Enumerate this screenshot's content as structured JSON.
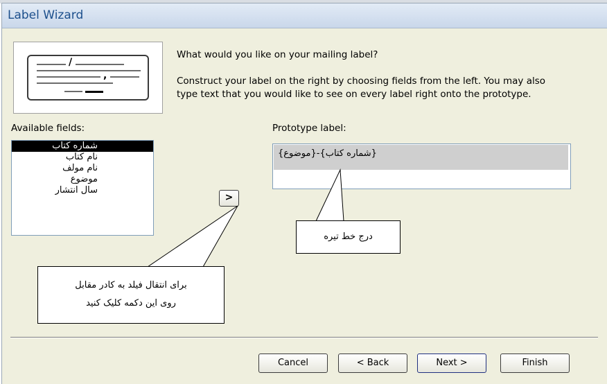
{
  "dialog": {
    "title": "Label Wizard",
    "heading": "What would you like on your mailing label?",
    "instructions_1": "Construct your label on the right by choosing fields from the left. You may also",
    "instructions_2": "type text that you would like to see on every label right onto the prototype."
  },
  "available_fields": {
    "label": "Available fields:",
    "items": [
      "شماره کتاب",
      "نام کتاب",
      "نام مولف",
      "موضوع",
      "سال انتشار"
    ],
    "selected_index": 0
  },
  "move_button": {
    "label": ">"
  },
  "prototype": {
    "label": "Prototype label:",
    "line_1": "{موضوع}-{شماره کتاب}"
  },
  "callouts": {
    "hyphen": "درج خط تیره",
    "move_line_1": "برای انتقال فیلد به کادر مقابل",
    "move_line_2": "روی این دکمه کلیک کنید"
  },
  "footer": {
    "cancel": "Cancel",
    "back": "< Back",
    "next": "Next >",
    "finish": "Finish"
  },
  "colors": {
    "dialog_bg": "#efefde",
    "title_text": "#1c4f8c",
    "selection_bg": "#000000",
    "prototype_line_bg": "#cfcfcf"
  }
}
